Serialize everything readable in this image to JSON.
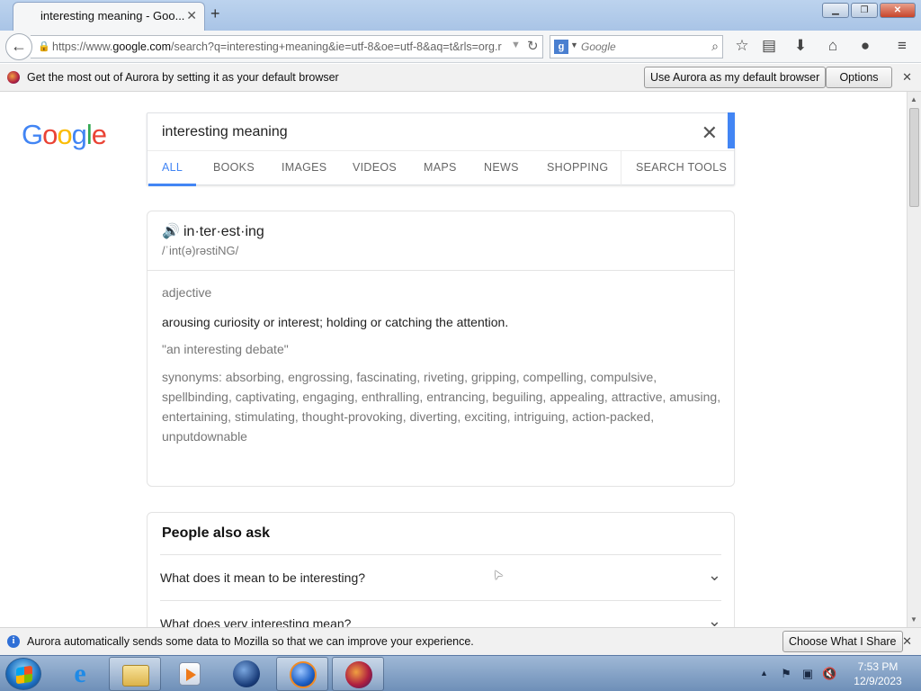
{
  "browser": {
    "tab_title": "interesting meaning - Goo...",
    "tab_close": "✕",
    "new_tab": "+",
    "window_buttons": {
      "minimize": "▁",
      "restore": "❐",
      "close": "✕"
    },
    "url": {
      "prefix": "https://www.",
      "domain": "google.com",
      "path": "/search?q=interesting+meaning&ie=utf-8&oe=utf-8&aq=t&rls=org.r"
    },
    "search_placeholder": "Google",
    "icons": {
      "back": "←",
      "lock": "🔒",
      "url_dropdown": "▼",
      "reload": "↻",
      "search_engine": "g",
      "search_engine_dropdown": "▼",
      "search_go": "⌕",
      "bookmark_star": "☆",
      "reading_list": "▤",
      "download": "⬇",
      "home": "⌂",
      "chat": "●",
      "menu": "≡"
    }
  },
  "default_notification": {
    "text": "Get the most out of Aurora by setting it as your default browser",
    "use_default_button": "Use Aurora as my default browser",
    "options_button": "Options",
    "close": "✕"
  },
  "google": {
    "logo": [
      "G",
      "o",
      "o",
      "g",
      "l",
      "e"
    ],
    "query": "interesting meaning",
    "clear": "✕",
    "tabs": [
      "ALL",
      "BOOKS",
      "IMAGES",
      "VIDEOS",
      "MAPS",
      "NEWS",
      "SHOPPING"
    ],
    "search_tools": "SEARCH TOOLS",
    "definition": {
      "speaker": "🔊",
      "word": "in·ter·est·ing",
      "phonetic": "/ˈint(ə)rəstiNG/",
      "part_of_speech": "adjective",
      "meaning": "arousing curiosity or interest; holding or catching the attention.",
      "example": "\"an interesting debate\"",
      "synonyms": "synonyms: absorbing, engrossing, fascinating, riveting, gripping, compelling, compulsive, spellbinding, captivating, engaging, enthralling, entrancing, beguiling, appealing, attractive, amusing, entertaining, stimulating, thought-provoking, diverting, exciting, intriguing, action-packed, unputdownable"
    },
    "people_also_ask": {
      "title": "People also ask",
      "questions": [
        "What does it mean to be interesting?",
        "What does very interesting mean?"
      ],
      "chevron": "⌄"
    }
  },
  "data_notification": {
    "icon": "i",
    "text": "Aurora automatically sends some data to Mozilla so that we can improve your experience.",
    "button": "Choose What I Share",
    "close": "✕"
  },
  "taskbar": {
    "tray_up": "▲",
    "tray_icons": [
      "⚑",
      "▣",
      "🔇"
    ],
    "time": "7:53 PM",
    "date": "12/9/2023"
  },
  "scrollbar": {
    "up": "▲",
    "down": "▼"
  },
  "cursor": "➤"
}
